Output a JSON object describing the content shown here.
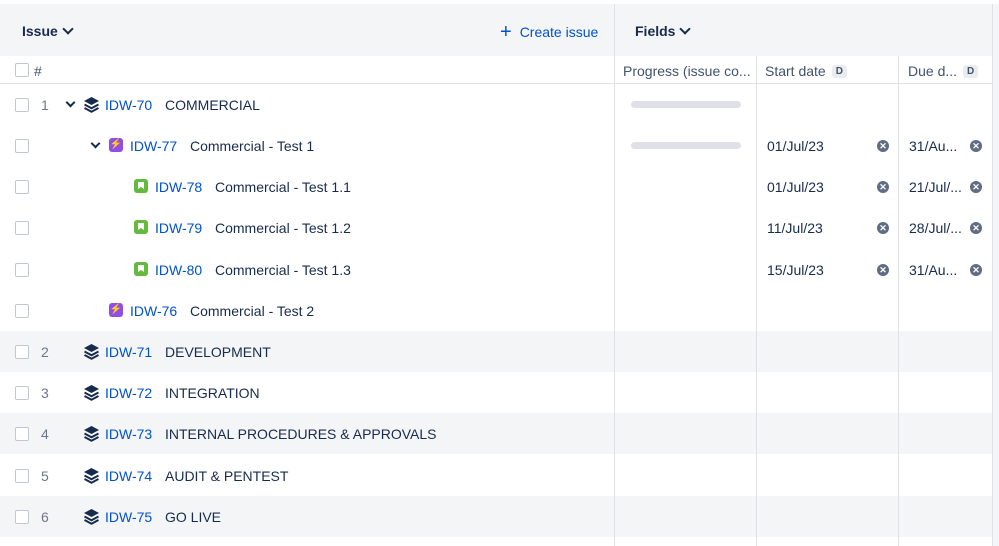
{
  "header": {
    "issue_label": "Issue",
    "create_label": "Create issue",
    "fields_label": "Fields"
  },
  "columns": {
    "number": "#",
    "progress": "Progress (issue co...",
    "start_date": "Start date",
    "start_badge": "D",
    "due_date": "Due d...",
    "due_badge": "D"
  },
  "rows": [
    {
      "num": "1",
      "key": "IDW-70",
      "summary": "COMMERCIAL",
      "type": "epic",
      "expanded": true,
      "progress": 0,
      "start": "",
      "due": ""
    },
    {
      "num": "",
      "key": "IDW-77",
      "summary": "Commercial - Test 1",
      "type": "task",
      "expanded": true,
      "progress": 0,
      "start": "01/Jul/23",
      "due": "31/Au..."
    },
    {
      "num": "",
      "key": "IDW-78",
      "summary": "Commercial - Test 1.1",
      "type": "story",
      "start": "01/Jul/23",
      "due": "21/Jul/..."
    },
    {
      "num": "",
      "key": "IDW-79",
      "summary": "Commercial - Test 1.2",
      "type": "story",
      "start": "11/Jul/23",
      "due": "28/Jul/..."
    },
    {
      "num": "",
      "key": "IDW-80",
      "summary": "Commercial - Test 1.3",
      "type": "story",
      "start": "15/Jul/23",
      "due": "31/Au..."
    },
    {
      "num": "",
      "key": "IDW-76",
      "summary": "Commercial - Test 2",
      "type": "task",
      "start": "",
      "due": ""
    },
    {
      "num": "2",
      "key": "IDW-71",
      "summary": "DEVELOPMENT",
      "type": "epic"
    },
    {
      "num": "3",
      "key": "IDW-72",
      "summary": "INTEGRATION",
      "type": "epic"
    },
    {
      "num": "4",
      "key": "IDW-73",
      "summary": "INTERNAL PROCEDURES & APPROVALS",
      "type": "epic"
    },
    {
      "num": "5",
      "key": "IDW-74",
      "summary": "AUDIT & PENTEST",
      "type": "epic"
    },
    {
      "num": "6",
      "key": "IDW-75",
      "summary": "GO LIVE",
      "type": "epic"
    }
  ],
  "icons": {
    "epic": "layers-icon",
    "task": "lightning-icon",
    "story": "bookmark-icon",
    "clear": "close-circle-icon",
    "create": "plus-icon",
    "dropdown": "chevron-down-icon"
  },
  "colors": {
    "link": "#0052cc",
    "task": "#904ee2",
    "story": "#63ba3c",
    "header_bg": "#f4f5f7"
  }
}
